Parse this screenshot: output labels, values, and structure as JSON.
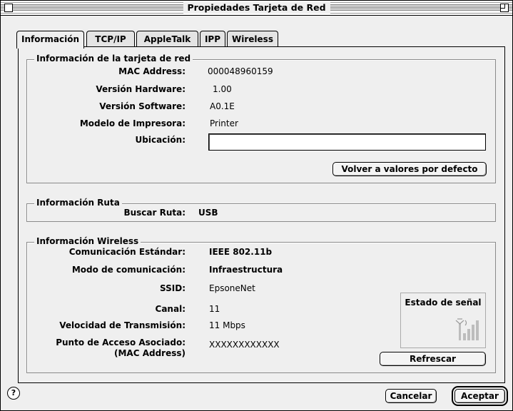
{
  "window": {
    "title": "Propiedades Tarjeta de Red"
  },
  "tabs": [
    {
      "label": "Información",
      "active": true
    },
    {
      "label": "TCP/IP"
    },
    {
      "label": "AppleTalk"
    },
    {
      "label": "IPP"
    },
    {
      "label": "Wireless"
    }
  ],
  "card_info": {
    "title": "Información de la tarjeta de red",
    "mac_label": "MAC Address:",
    "mac_value": "000048960159",
    "hw_label": "Versión Hardware:",
    "hw_value": "1.00",
    "sw_label": "Versión Software:",
    "sw_value": "A0.1E",
    "printer_label": "Modelo de Impresora:",
    "printer_value": "Printer",
    "location_label": "Ubicación:",
    "location_value": "",
    "reset_button": "Volver a valores por defecto"
  },
  "route_info": {
    "title": "Información Ruta",
    "search_label": "Buscar Ruta:",
    "search_value": "USB"
  },
  "wireless_info": {
    "title": "Información Wireless",
    "standard_label": "Comunicación Estándar:",
    "standard_value": "IEEE 802.11b",
    "mode_label": "Modo de comunicación:",
    "mode_value": "Infraestructura",
    "ssid_label": "SSID:",
    "ssid_value": "EpsoneNet",
    "channel_label": "Canal:",
    "channel_value": "11",
    "speed_label": "Velocidad de Transmisión:",
    "speed_value": "11 Mbps",
    "ap_label_line1": "Punto de Acceso Asociado:",
    "ap_label_line2": "(MAC Address)",
    "ap_value": "XXXXXXXXXXXX",
    "signal_title": "Estado de señal",
    "refresh_button": "Refrescar"
  },
  "footer": {
    "help_glyph": "?",
    "cancel_button": "Cancelar",
    "accept_button": "Aceptar"
  }
}
